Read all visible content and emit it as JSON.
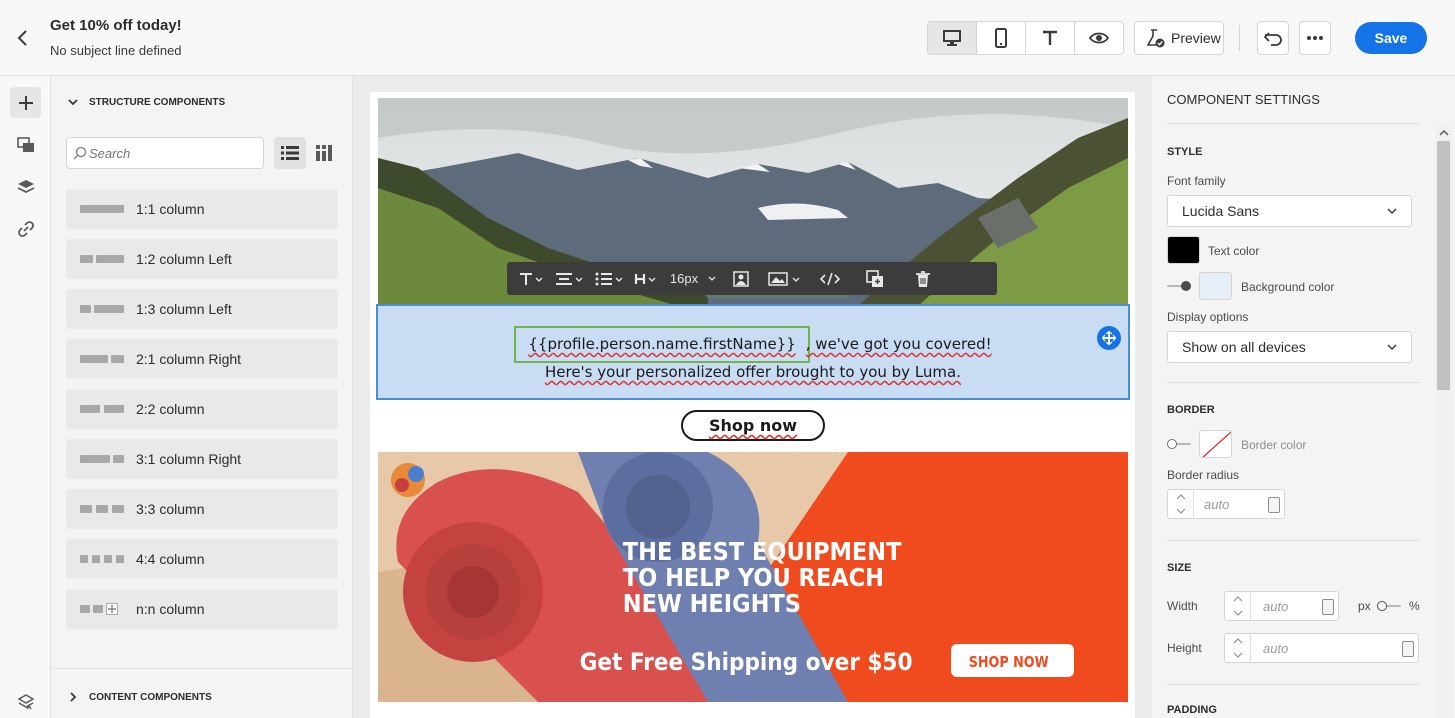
{
  "header": {
    "title": "Get 10% off today!",
    "subtitle": "No subject line defined",
    "view_modes": [
      "desktop-icon",
      "mobile-icon",
      "text-icon",
      "eye-icon"
    ],
    "preview_label": "Preview",
    "save_label": "Save"
  },
  "rail": {
    "items": [
      "plus-icon",
      "assets-icon",
      "layers-icon",
      "link-icon",
      "navigator-icon"
    ]
  },
  "left_panel": {
    "structure_heading": "Structure components",
    "search_placeholder": "Search",
    "components": [
      {
        "label": "1:1 column"
      },
      {
        "label": "1:2 column Left"
      },
      {
        "label": "1:3 column Left"
      },
      {
        "label": "2:1 column Right"
      },
      {
        "label": "2:2 column"
      },
      {
        "label": "3:1 column Right"
      },
      {
        "label": "3:3 column"
      },
      {
        "label": "4:4 column"
      },
      {
        "label": "n:n column"
      }
    ],
    "content_heading": "Content components"
  },
  "canvas": {
    "toolbar": {
      "font_size": "16px"
    },
    "personalization_token": "{{profile.person.name.firstName}}",
    "line1_rest": ", we've got you covered!",
    "line2": "Here's your personalized offer brought to you by Luma.",
    "button_label": "Shop now",
    "banner": {
      "headline": [
        "THE BEST EQUIPMENT",
        "TO HELP YOU REACH",
        "NEW HEIGHTS"
      ],
      "shipping": "Get Free Shipping over $50",
      "cta": "SHOP NOW",
      "colors": {
        "orange": "#f04b1e",
        "mat_red": "#d9514f",
        "mat_blue": "#6e7fb0"
      }
    }
  },
  "right_panel": {
    "title": "Component settings",
    "style_heading": "Style",
    "font_family_label": "Font family",
    "font_family_value": "Lucida Sans",
    "text_color_label": "Text color",
    "text_color": "#000000",
    "background_color_label": "Background color",
    "background_color": "#e6eef8",
    "display_options_label": "Display options",
    "display_options_value": "Show on all devices",
    "border_heading": "Border",
    "border_color_label": "Border color",
    "border_radius_label": "Border radius",
    "border_radius_value": "auto",
    "size_heading": "Size",
    "width_label": "Width",
    "width_value": "auto",
    "unit_px": "px",
    "unit_pct": "%",
    "height_label": "Height",
    "height_value": "auto",
    "padding_heading": "Padding"
  },
  "colors": {
    "accent": "#1473e6",
    "selection_fill": "#c8dcf4",
    "token_outline": "#6fb64a"
  }
}
